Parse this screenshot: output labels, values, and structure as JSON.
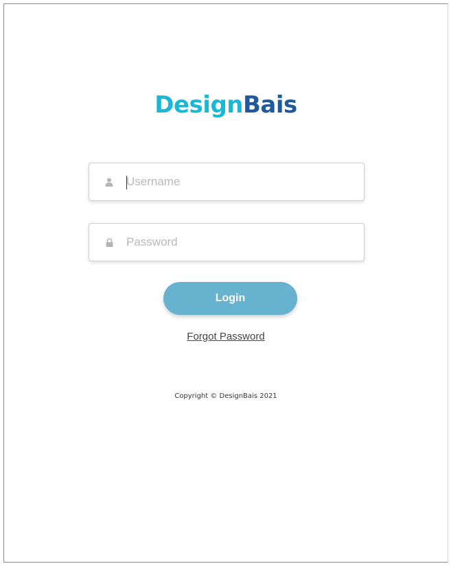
{
  "brand": {
    "part1": "Design",
    "part2": "Bais",
    "colors": {
      "part1": "#1bb8d6",
      "part2": "#1f5b9c"
    }
  },
  "form": {
    "username": {
      "placeholder": "Username",
      "value": "",
      "icon": "user-icon"
    },
    "password": {
      "placeholder": "Password",
      "value": "",
      "icon": "lock-icon"
    },
    "login_label": "Login",
    "login_color": "#67b3cf",
    "forgot_label": "Forgot Password"
  },
  "footer": {
    "copyright": "Copyright © DesignBais 2021"
  }
}
